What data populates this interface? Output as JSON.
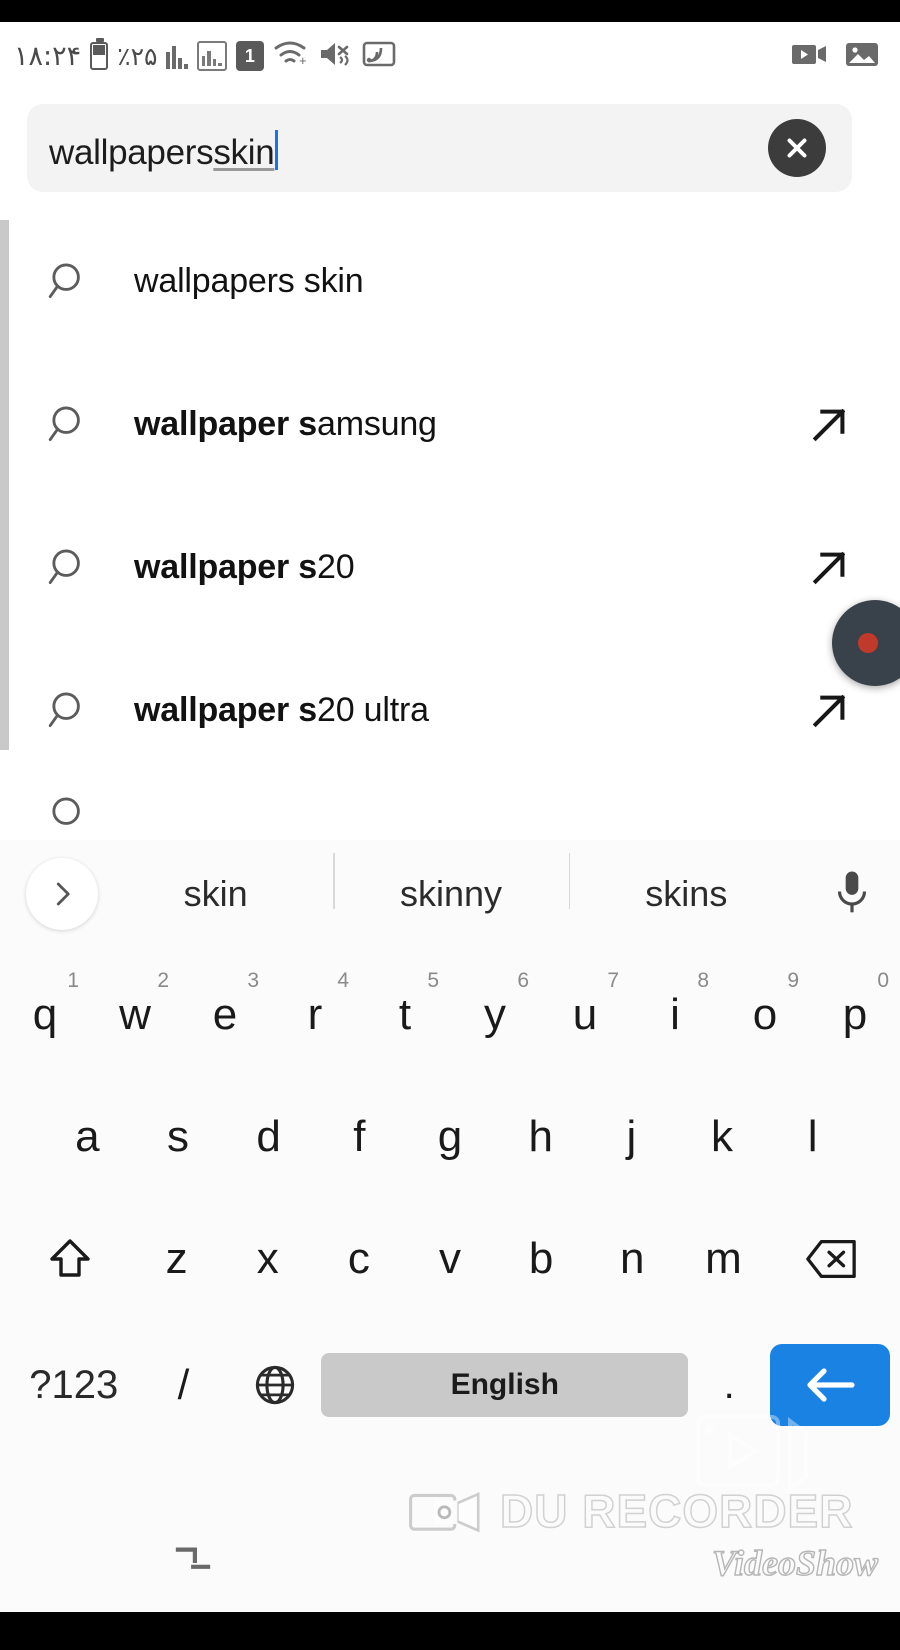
{
  "statusbar": {
    "clock": "١٨:٢۴",
    "battery_percent": "٪٢۵",
    "icons": {
      "battery": "battery-icon",
      "signal": "signal-bars-icon",
      "sim_signal": "sim-signal-icon",
      "sim_number": "1",
      "wifi": "wifi-icon",
      "mute": "volume-mute-icon",
      "cast": "screen-cast-icon",
      "screen_record": "video-record-icon",
      "gallery": "image-icon"
    }
  },
  "search": {
    "value_committed": "wallpapers ",
    "value_composing": "skin",
    "clear_label": "clear-search",
    "full_value": "wallpapers skin"
  },
  "suggestions": {
    "items": [
      {
        "bold": "wallpapers skin",
        "rest": "",
        "has_arrow": false,
        "weight": "regular"
      },
      {
        "bold": "wallpaper s",
        "rest": "amsung",
        "has_arrow": true,
        "weight": "bold"
      },
      {
        "bold": "wallpaper s",
        "rest": "20",
        "has_arrow": true,
        "weight": "bold"
      },
      {
        "bold": "wallpaper s",
        "rest": "20 ultra",
        "has_arrow": true,
        "weight": "bold"
      }
    ]
  },
  "recorder_bubble": {
    "name": "floating-record-button"
  },
  "keyboard": {
    "candidates": [
      "skin",
      "skinny",
      "skins"
    ],
    "expand_label": "›",
    "mic_label": "voice-input",
    "row1": [
      {
        "key": "q",
        "num": "1"
      },
      {
        "key": "w",
        "num": "2"
      },
      {
        "key": "e",
        "num": "3"
      },
      {
        "key": "r",
        "num": "4"
      },
      {
        "key": "t",
        "num": "5"
      },
      {
        "key": "y",
        "num": "6"
      },
      {
        "key": "u",
        "num": "7"
      },
      {
        "key": "i",
        "num": "8"
      },
      {
        "key": "o",
        "num": "9"
      },
      {
        "key": "p",
        "num": "0"
      }
    ],
    "row2": [
      "a",
      "s",
      "d",
      "f",
      "g",
      "h",
      "j",
      "k",
      "l"
    ],
    "row3": [
      "z",
      "x",
      "c",
      "v",
      "b",
      "n",
      "m"
    ],
    "shift_label": "shift-key",
    "backspace_label": "backspace-key",
    "symbols_label": "?123",
    "slash_label": "/",
    "globe_label": "language-switch",
    "space_label": "English",
    "period_label": ".",
    "enter_label": "enter-key"
  },
  "navbar": {
    "recents_label": "recents-button"
  },
  "watermarks": {
    "du_recorder": "DU RECORDER",
    "videoshow": "VideoShow"
  },
  "colors": {
    "accent_blue": "#1a82e2",
    "caret_blue": "#1a73e8",
    "search_bg": "#f3f3f3",
    "keyboard_bg": "#fbfbfb",
    "spacebar_gray": "#c9c9c9",
    "record_red": "#c0392b"
  }
}
